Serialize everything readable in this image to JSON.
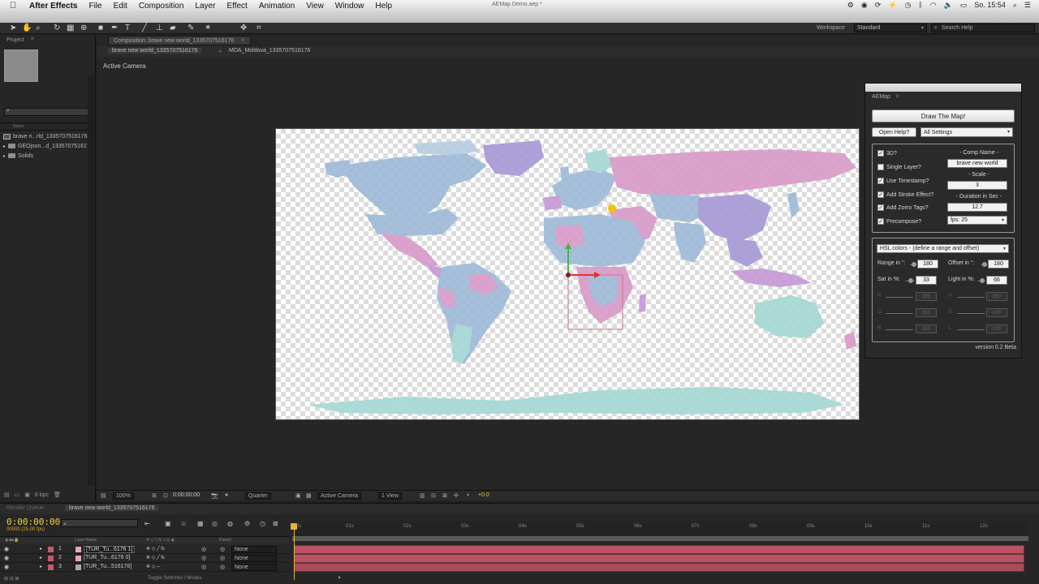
{
  "menubar": {
    "app": "After Effects",
    "items": [
      "File",
      "Edit",
      "Composition",
      "Layer",
      "Effect",
      "Animation",
      "View",
      "Window",
      "Help"
    ],
    "doc_title": "AEMap Demo.aep *",
    "clock": "So. 15:54"
  },
  "toolbar": {
    "workspace_label": "Workspace",
    "workspace_value": "Standard",
    "help_placeholder": "Search Help"
  },
  "project": {
    "tab": "Project",
    "column": "Name",
    "items": [
      {
        "label": "brave n...rld_1335707516176",
        "type": "comp"
      },
      {
        "label": "GEOjson...d_1335707516176",
        "type": "folder"
      },
      {
        "label": "Solids",
        "type": "folder"
      }
    ],
    "bpc": "8 bpc"
  },
  "composition": {
    "tab": "Composition: brave new world_1335707516176",
    "subtabs": [
      "brave new world_1335707516176",
      "MDA_Moldova_1335707516176"
    ],
    "view_label": "Active Camera",
    "footer": {
      "zoom": "100%",
      "time": "0:00:00:00",
      "resolution": "Quarter",
      "camera": "Active Camera",
      "views": "1 View",
      "exposure": "+0.0"
    }
  },
  "aemap": {
    "title": "AEMap",
    "draw_button": "Draw The Map!",
    "help_button": "Open Help?",
    "settings_select": "All Settings",
    "options": [
      {
        "label": "3D?",
        "checked": true
      },
      {
        "label": "Single Layer?",
        "checked": false
      },
      {
        "label": "Use Timestamp?",
        "checked": true
      },
      {
        "label": "Add Stroke Effect?",
        "checked": true
      },
      {
        "label": "Add Zorro Tags?",
        "checked": true
      },
      {
        "label": "Precompose?",
        "checked": true
      }
    ],
    "comp_name_label": "- Comp Name -",
    "comp_name_value": "brave new world",
    "scale_label": "- Scale -",
    "scale_value": "3",
    "duration_label": "- Duration in Sec -",
    "duration_value": "12.7",
    "fps_value": "fps: 25",
    "color_mode": "HSL colors - (define a range and offset)",
    "range_label": "Range in °:",
    "range_value": "180",
    "offset_label": "Offset in °:",
    "offset_value": "180",
    "sat_label": "Sat in %:",
    "sat_value": "33",
    "light_label": "Light in %:",
    "light_value": "66",
    "disabled": {
      "r_label": "R",
      "r_value": "255",
      "g_label": "G",
      "g_value": "255",
      "b_label": "B",
      "b_value": "255",
      "h_label": "H",
      "h_value": "360",
      "s_label": "S",
      "s_value": "100",
      "l_label": "L",
      "l_value": "100"
    },
    "version": "version 0.2 Beta"
  },
  "timeline": {
    "tabs": [
      "Render Queue",
      "brave new world_1335707516176"
    ],
    "timecode": "0:00:00:00",
    "timecode_sub": "00000 (25.00 fps)",
    "header_layer": "Layer Name",
    "header_parent": "Parent",
    "ruler": [
      "0s",
      "01s",
      "02s",
      "03s",
      "04s",
      "05s",
      "06s",
      "07s",
      "08s",
      "09s",
      "10s",
      "11s",
      "12s"
    ],
    "layers": [
      {
        "num": "1",
        "name": "[TUR_Tu...6176 1]",
        "parent": "None"
      },
      {
        "num": "2",
        "name": "[TUR_Tu...6176 0]",
        "parent": "None"
      },
      {
        "num": "3",
        "name": "[TUR_Tu...516176]",
        "parent": "None"
      }
    ],
    "footer": "Toggle Switches / Modes"
  },
  "colors": {
    "timecode": "#f1d24a",
    "layer_bar": "#b85562",
    "map_purple": "#a89ad6",
    "map_pink": "#d99bc9",
    "map_blue": "#9fbbd8",
    "map_teal": "#a6d8d4"
  }
}
